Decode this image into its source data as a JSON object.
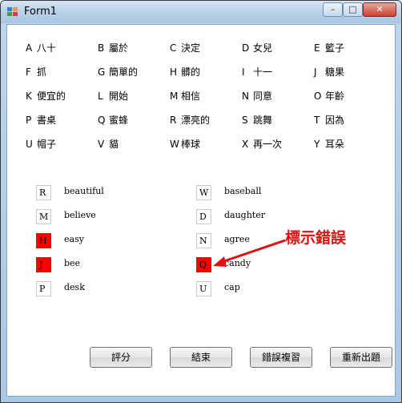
{
  "window": {
    "title": "Form1",
    "controls": {
      "minimize": "–",
      "maximize": "□",
      "close": "✕"
    }
  },
  "letter_map": [
    {
      "letter": "A",
      "word": "八十"
    },
    {
      "letter": "B",
      "word": "屬於"
    },
    {
      "letter": "C",
      "word": "決定"
    },
    {
      "letter": "D",
      "word": "女兒"
    },
    {
      "letter": "E",
      "word": "籃子"
    },
    {
      "letter": "F",
      "word": "抓"
    },
    {
      "letter": "G",
      "word": "簡單的"
    },
    {
      "letter": "H",
      "word": "髒的"
    },
    {
      "letter": "I",
      "word": "十一"
    },
    {
      "letter": "J",
      "word": "糖果"
    },
    {
      "letter": "K",
      "word": "便宜的"
    },
    {
      "letter": "L",
      "word": "開始"
    },
    {
      "letter": "M",
      "word": "相信"
    },
    {
      "letter": "N",
      "word": "同意"
    },
    {
      "letter": "O",
      "word": "年齡"
    },
    {
      "letter": "P",
      "word": "書桌"
    },
    {
      "letter": "Q",
      "word": "蜜蜂"
    },
    {
      "letter": "R",
      "word": "漂亮的"
    },
    {
      "letter": "S",
      "word": "跳舞"
    },
    {
      "letter": "T",
      "word": "因為"
    },
    {
      "letter": "U",
      "word": "帽子"
    },
    {
      "letter": "V",
      "word": "貓"
    },
    {
      "letter": "W",
      "word": "棒球"
    },
    {
      "letter": "X",
      "word": "再一次"
    },
    {
      "letter": "Y",
      "word": "耳朵"
    }
  ],
  "questions": [
    {
      "answer": "R",
      "word": "beautiful",
      "wrong": false
    },
    {
      "answer": "M",
      "word": "believe",
      "wrong": false
    },
    {
      "answer": "H",
      "word": "easy",
      "wrong": true
    },
    {
      "answer": "J",
      "word": "bee",
      "wrong": true
    },
    {
      "answer": "P",
      "word": "desk",
      "wrong": false
    },
    {
      "answer": "W",
      "word": "baseball",
      "wrong": false
    },
    {
      "answer": "D",
      "word": "daughter",
      "wrong": false
    },
    {
      "answer": "N",
      "word": "agree",
      "wrong": false
    },
    {
      "answer": "Q",
      "word": "candy",
      "wrong": true
    },
    {
      "answer": "U",
      "word": "cap",
      "wrong": false
    }
  ],
  "buttons": {
    "grade": "評分",
    "exit": "結束",
    "review_errors": "錯誤複習",
    "new_quiz": "重新出題"
  },
  "annotation": {
    "text": "標示錯誤",
    "color": "#e01010"
  },
  "colors": {
    "wrong_fill": "#ff0000"
  }
}
